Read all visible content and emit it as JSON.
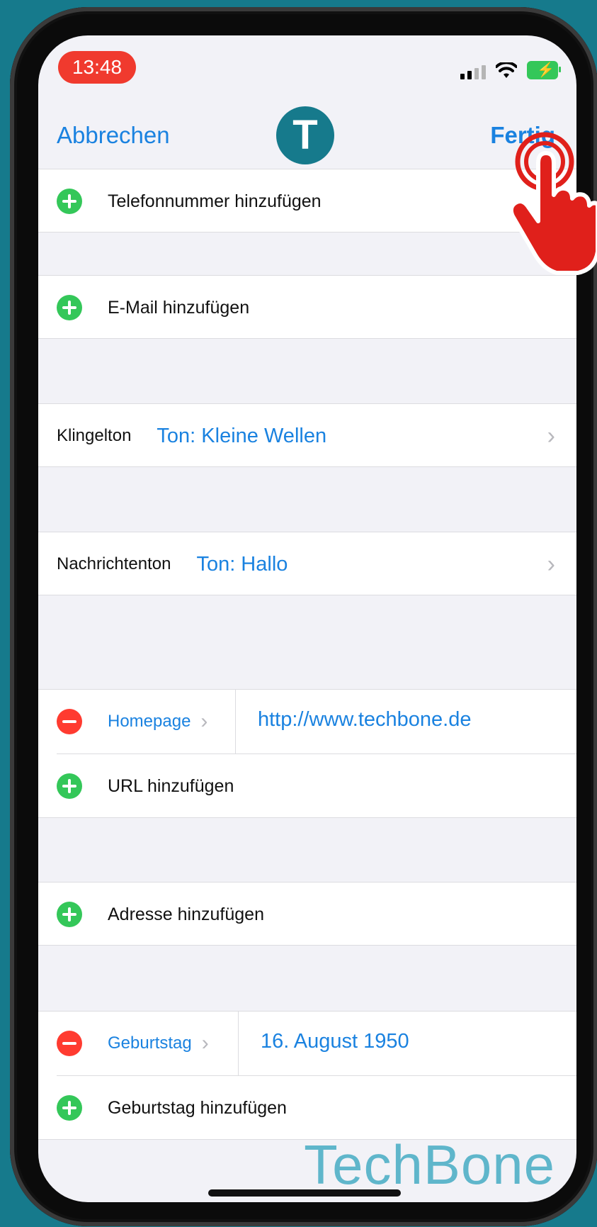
{
  "status_bar": {
    "time": "13:48"
  },
  "nav": {
    "cancel_label": "Abbrechen",
    "avatar_letter": "T",
    "done_label": "Fertig"
  },
  "rows": {
    "add_phone": "Telefonnummer hinzufügen",
    "add_email": "E-Mail hinzufügen",
    "ringtone_label": "Klingelton",
    "ringtone_value": "Ton: Kleine Wellen",
    "text_tone_label": "Nachrichtenton",
    "text_tone_value": "Ton: Hallo",
    "homepage_type": "Homepage",
    "homepage_value": "http://www.techbone.de",
    "add_url": "URL hinzufügen",
    "add_address": "Adresse hinzufügen",
    "birthday_type": "Geburtstag",
    "birthday_value": "16. August 1950",
    "add_birthday": "Geburtstag hinzufügen"
  },
  "watermark": "TechBone",
  "colors": {
    "accent": "#1a82e0",
    "add": "#34c759",
    "remove": "#ff3b30",
    "background": "#167a8c"
  }
}
